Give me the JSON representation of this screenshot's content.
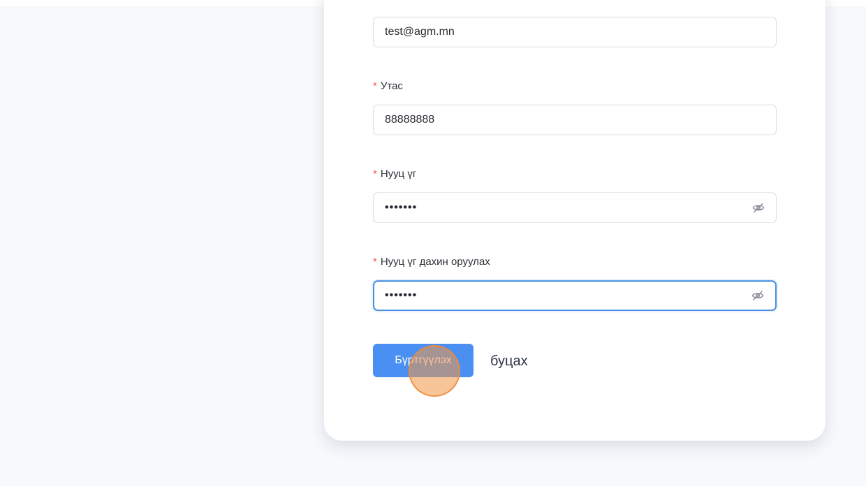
{
  "form": {
    "email_value": "test@agm.mn",
    "required_mark": "*",
    "phone_label": "Утас",
    "phone_value": "88888888",
    "password_label": "Нууц үг",
    "password_value": "•••••••",
    "confirm_label": "Нууц үг дахин оруулах",
    "confirm_value": "•••••••",
    "password_visibility_icon": "eye-off-icon",
    "submit_label": "Бүртгүүлэх",
    "back_label": "буцах"
  },
  "colors": {
    "page_background": "#f7f9fc",
    "card_background": "#ffffff",
    "primary_button": "#4a90f2",
    "required_mark": "#ff4d4f",
    "focus_border": "#4a90e2",
    "click_marker": "#f39646"
  }
}
